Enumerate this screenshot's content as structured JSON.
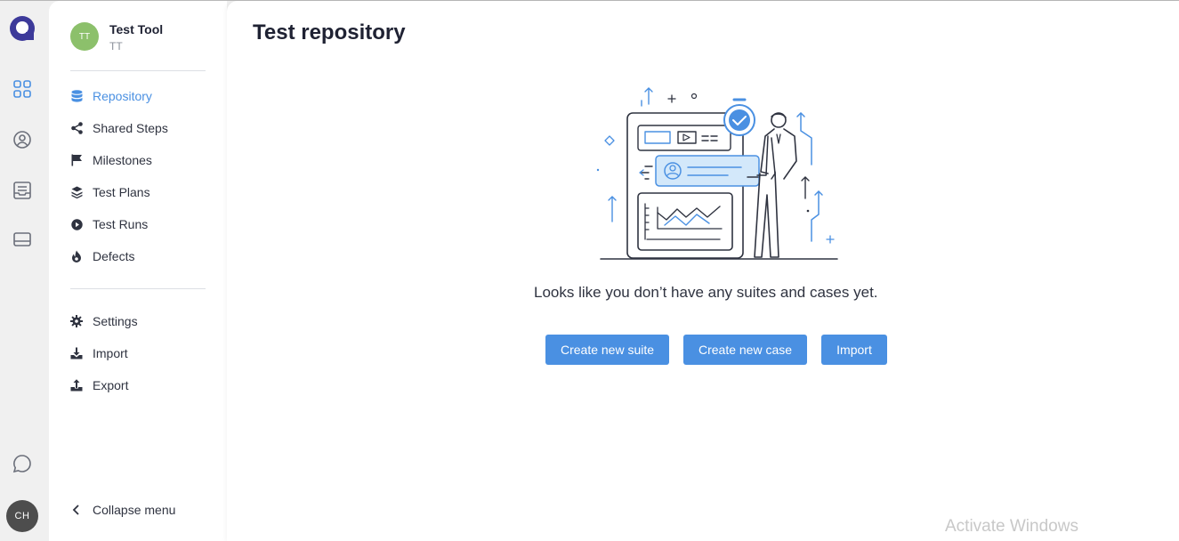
{
  "project": {
    "name": "Test Tool",
    "code": "TT",
    "avatar_initials": "TT"
  },
  "nav": {
    "primary": [
      {
        "label": "Repository",
        "icon": "database-icon",
        "active": true
      },
      {
        "label": "Shared Steps",
        "icon": "share-icon"
      },
      {
        "label": "Milestones",
        "icon": "flag-icon"
      },
      {
        "label": "Test Plans",
        "icon": "layers-icon"
      },
      {
        "label": "Test Runs",
        "icon": "play-icon"
      },
      {
        "label": "Defects",
        "icon": "flame-icon"
      }
    ],
    "secondary": [
      {
        "label": "Settings",
        "icon": "gear-icon"
      },
      {
        "label": "Import",
        "icon": "download-icon"
      },
      {
        "label": "Export",
        "icon": "upload-icon"
      }
    ],
    "collapse_label": "Collapse menu"
  },
  "rail": {
    "icons": [
      "projects-grid-icon",
      "user-circle-icon",
      "inbox-icon",
      "workspace-icon"
    ],
    "chat_icon": "chat-icon",
    "user_initials": "CH"
  },
  "main": {
    "title": "Test repository",
    "empty_message": "Looks like you don’t have any suites and cases yet.",
    "buttons": {
      "create_suite": "Create new suite",
      "create_case": "Create new case",
      "import": "Import"
    }
  },
  "watermark": "Activate Windows",
  "colors": {
    "accent": "#4a90e2",
    "project_avatar": "#8cc06b",
    "logo": "#3d3a9a"
  }
}
